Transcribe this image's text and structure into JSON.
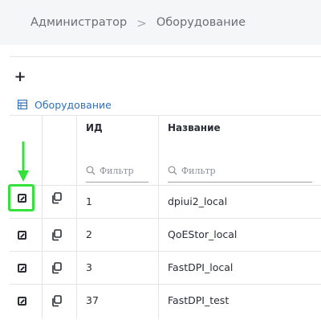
{
  "breadcrumb": {
    "items": [
      "Администратор",
      "Оборудование"
    ],
    "separator": ">"
  },
  "toolbar": {
    "add_label": "+"
  },
  "section": {
    "title": "Оборудование",
    "icon": "table-icon"
  },
  "table": {
    "columns": [
      "ИД",
      "Название"
    ],
    "filter_placeholder": "Фильтр",
    "rows": [
      {
        "id": "1",
        "name": "dpiui2_local"
      },
      {
        "id": "2",
        "name": "QoEStor_local"
      },
      {
        "id": "3",
        "name": "FastDPI_local"
      },
      {
        "id": "37",
        "name": "FastDPI_test"
      }
    ]
  },
  "annotation": {
    "color": "#36e03a",
    "target": "edit-button row 1"
  }
}
